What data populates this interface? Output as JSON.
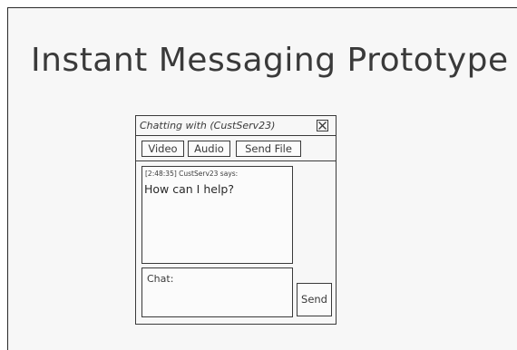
{
  "page": {
    "title": "Instant Messaging Prototype"
  },
  "window": {
    "title": "Chatting with (CustServ23)",
    "close_icon": "close-icon"
  },
  "toolbar": {
    "video_label": "Video",
    "audio_label": "Audio",
    "send_file_label": "Send File"
  },
  "transcript": {
    "messages": [
      {
        "header": "[2:48:35] CustServ23 says:",
        "text": "How can I help?"
      }
    ]
  },
  "composer": {
    "label": "Chat:",
    "send_label": "Send"
  }
}
